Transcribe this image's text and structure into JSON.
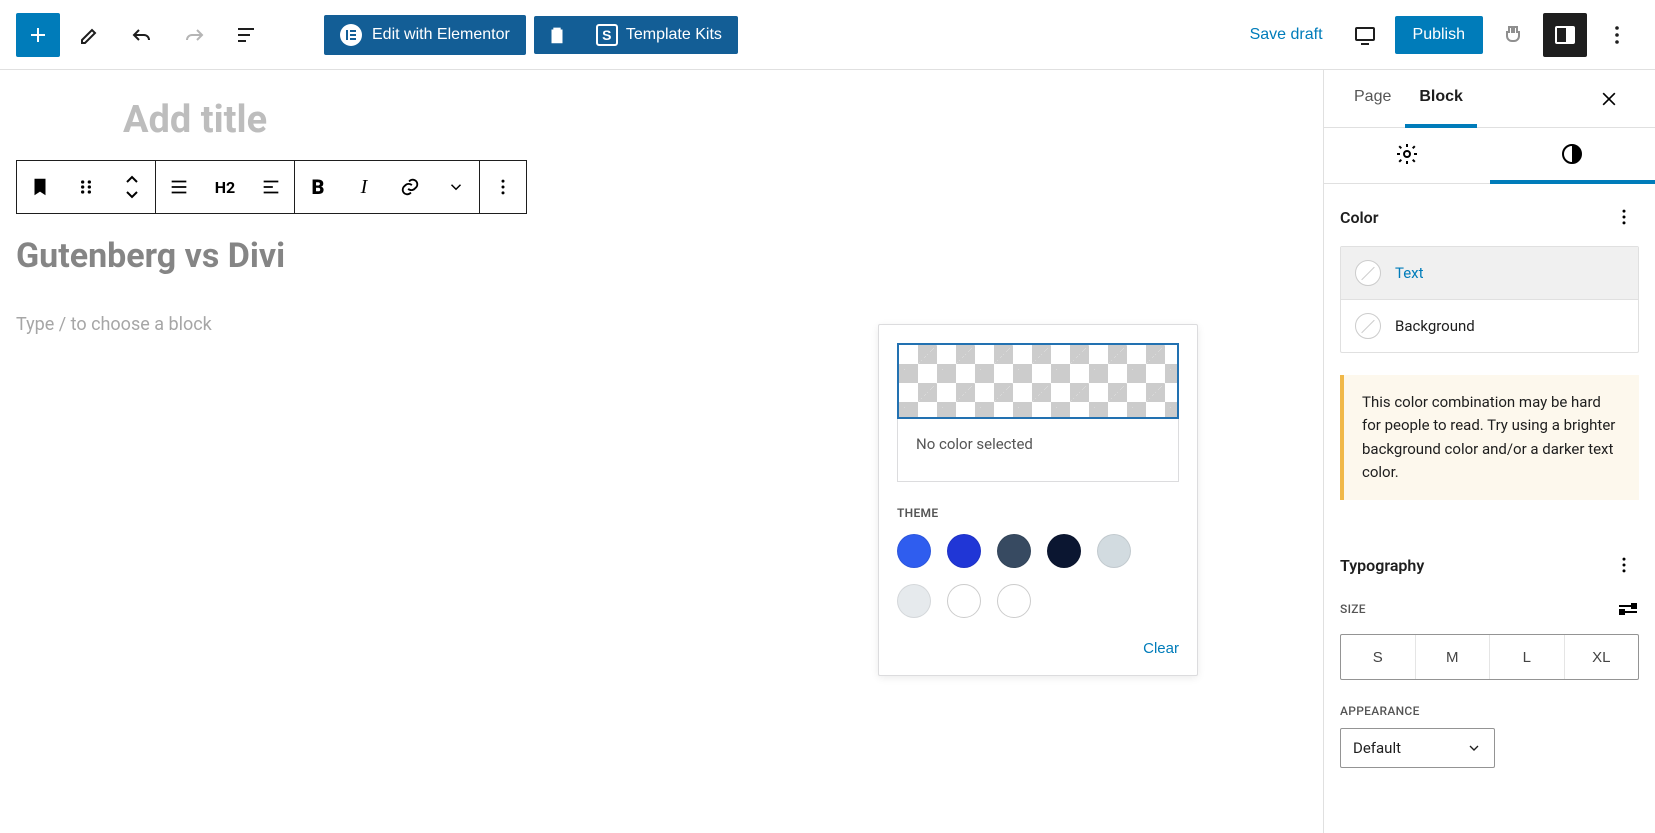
{
  "toolbar": {
    "elementor_label": "Edit with Elementor",
    "template_kits_label": "Template Kits",
    "save_draft_label": "Save draft",
    "publish_label": "Publish"
  },
  "editor": {
    "title_placeholder": "Add title",
    "heading_text": "Gutenberg vs Divi",
    "block_prompt": "Type / to choose a block",
    "heading_level": "H2"
  },
  "popover": {
    "no_color_label": "No color selected",
    "theme_heading": "THEME",
    "clear_label": "Clear",
    "swatches": [
      "#2f5def",
      "#2036d6",
      "#374a61",
      "#0b1631",
      "#d2dbe0",
      "#e6eaed",
      "#ffffff",
      "#ffffff"
    ]
  },
  "sidebar": {
    "tabs": {
      "page": "Page",
      "block": "Block"
    },
    "color": {
      "heading": "Color",
      "text_label": "Text",
      "background_label": "Background",
      "notice": "This color combination may be hard for people to read. Try using a brighter background color and/or a darker text color."
    },
    "typography": {
      "heading": "Typography",
      "size_label": "SIZE",
      "sizes": [
        "S",
        "M",
        "L",
        "XL"
      ],
      "appearance_label": "APPEARANCE",
      "appearance_value": "Default"
    }
  }
}
